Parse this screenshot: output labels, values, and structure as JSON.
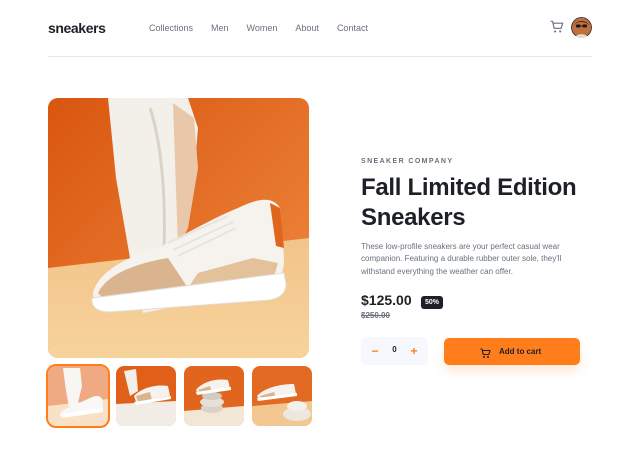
{
  "header": {
    "logo": "sneakers",
    "nav": [
      "Collections",
      "Men",
      "Women",
      "About",
      "Contact"
    ],
    "cart_icon": "cart-icon",
    "avatar_icon": "user-avatar"
  },
  "product": {
    "company": "SNEAKER COMPANY",
    "title": "Fall Limited Edition Sneakers",
    "description": "These low-profile sneakers are your perfect casual wear companion. Featuring a durable rubber outer sole, they'll withstand everything the weather can offer.",
    "price": "$125.00",
    "discount": "50%",
    "old_price": "$250.00"
  },
  "quantity": {
    "minus": "−",
    "value": "0",
    "plus": "+"
  },
  "cart_button": {
    "label": "Add to cart",
    "icon": "cart-icon"
  },
  "gallery": {
    "active_index": 0,
    "thumbnails": [
      "thumbnail-1",
      "thumbnail-2",
      "thumbnail-3",
      "thumbnail-4"
    ]
  },
  "colors": {
    "accent": "#ff7e1b",
    "dark": "#1d2026",
    "muted": "#69707d",
    "light": "#f6f8fd"
  }
}
